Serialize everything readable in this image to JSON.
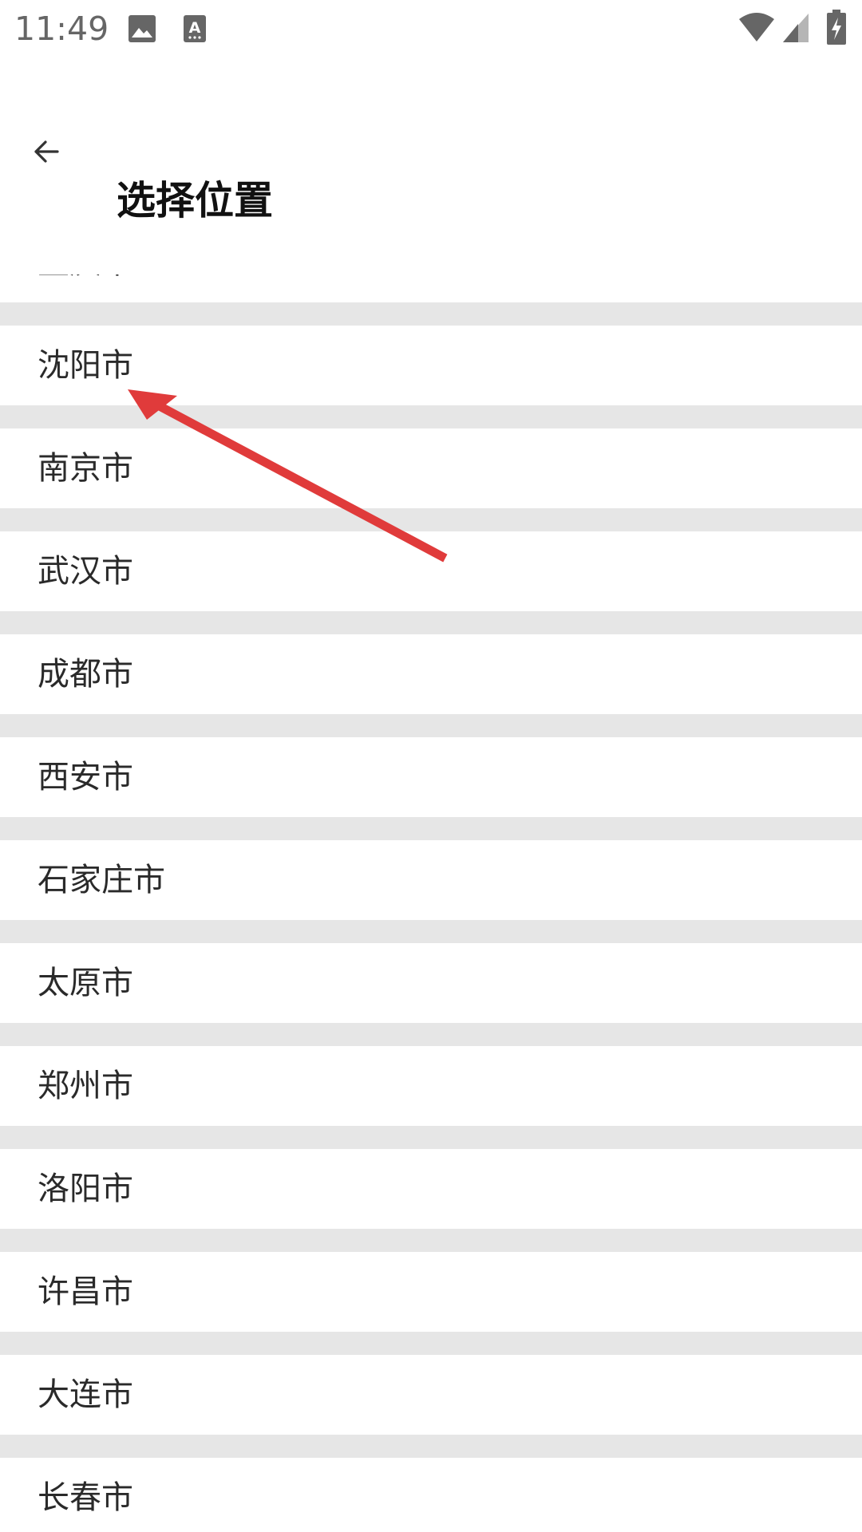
{
  "status_bar": {
    "time": "11:49",
    "icons": [
      "image-icon",
      "text-a-icon",
      "wifi-icon",
      "signal-icon",
      "battery-charging-icon"
    ]
  },
  "app_bar": {
    "back_icon": "arrow-left-icon",
    "title": "选择位置"
  },
  "list": {
    "items": [
      "重庆市",
      "沈阳市",
      "南京市",
      "武汉市",
      "成都市",
      "西安市",
      "石家庄市",
      "太原市",
      "郑州市",
      "洛阳市",
      "许昌市",
      "大连市",
      "长春市"
    ]
  },
  "annotation": {
    "type": "arrow",
    "color": "#e03b3b",
    "target": "沈阳市"
  },
  "colors": {
    "divider": "#e6e6e6",
    "background": "#ffffff",
    "text": "#2a2a2a"
  }
}
